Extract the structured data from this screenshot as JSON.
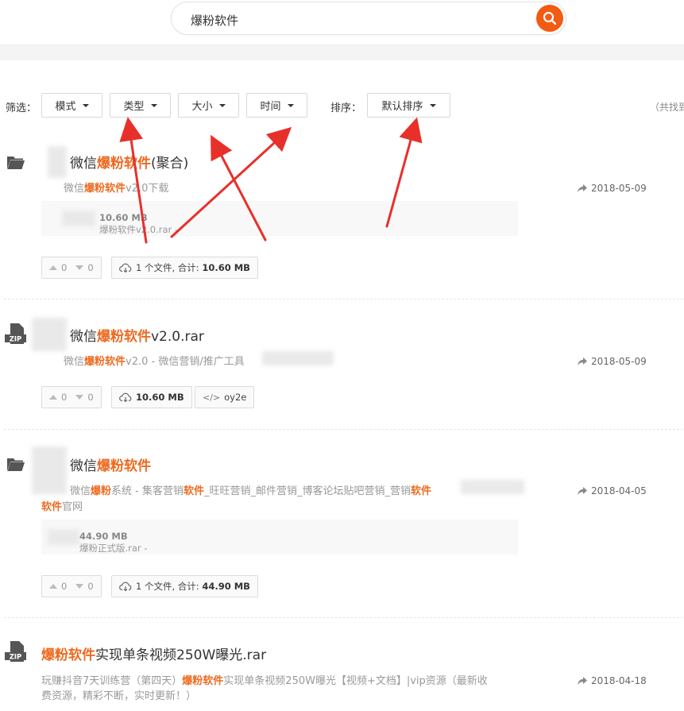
{
  "search": {
    "value": "爆粉软件"
  },
  "filters": {
    "filter_label": "筛选：",
    "mode": "模式",
    "type": "类型",
    "size": "大小",
    "time": "时间",
    "sort_label": "排序：",
    "sort": "默认排序",
    "total": "（共找到"
  },
  "results": [
    {
      "icon": "folder-icon",
      "title_pre": "微信",
      "title_hl": "爆粉软件",
      "title_post": "(聚合)",
      "desc_pre": "微信",
      "desc_hl": "爆粉软件",
      "desc_post": "v2.0下载",
      "file_line": "爆粉软件v2.0.rar - ",
      "file_size": "10.60 MB",
      "date": "2018-05-09",
      "up": "0",
      "down": "0",
      "files_pre": "1 个文件, 合计: ",
      "files_size": "10.60 MB"
    },
    {
      "icon": "zip-icon",
      "title_pre": "微信",
      "title_hl": "爆粉软件",
      "title_post": "v2.0.rar",
      "desc_pre": "微信",
      "desc_hl": "爆粉软件",
      "desc_post": "v2.0 - 微信营销/推广工具",
      "date": "2018-05-09",
      "up": "0",
      "down": "0",
      "size": "10.60 MB",
      "code": "oy2e"
    },
    {
      "icon": "folder-icon",
      "title_pre": "微信",
      "title_hl": "爆粉软件",
      "title_post": "",
      "desc_a": "微信",
      "desc_b": "爆粉",
      "desc_c": "系统 - 集客营销",
      "desc_d": "软件",
      "desc_e": "_旺旺营销_邮件营销_博客论坛贴吧营销_营销",
      "desc_f": "软件",
      "desc2_hl": "软件",
      "desc2_post": "官网",
      "file_line": "爆粉正式版.rar - ",
      "file_size": "44.90 MB",
      "date": "2018-04-05",
      "up": "0",
      "down": "0",
      "files_pre": "1 个文件, 合计: ",
      "files_size": "44.90 MB"
    },
    {
      "icon": "zip-icon",
      "title_hl": "爆粉软件",
      "title_post": "实现单条视频250W曝光.rar",
      "desc_pre": "玩赚抖音7天训练营（第四天）",
      "desc_hl": "爆粉软件",
      "desc_post": "实现单条视频250W曝光【视频+文档】|vip资源（最新收",
      "desc_line2": "费资源，精彩不断，实时更新！）",
      "date": "2018-04-18"
    }
  ],
  "colors": {
    "accent": "#f35a12",
    "highlight": "#ee6a21",
    "arrow": "#e8302b"
  }
}
